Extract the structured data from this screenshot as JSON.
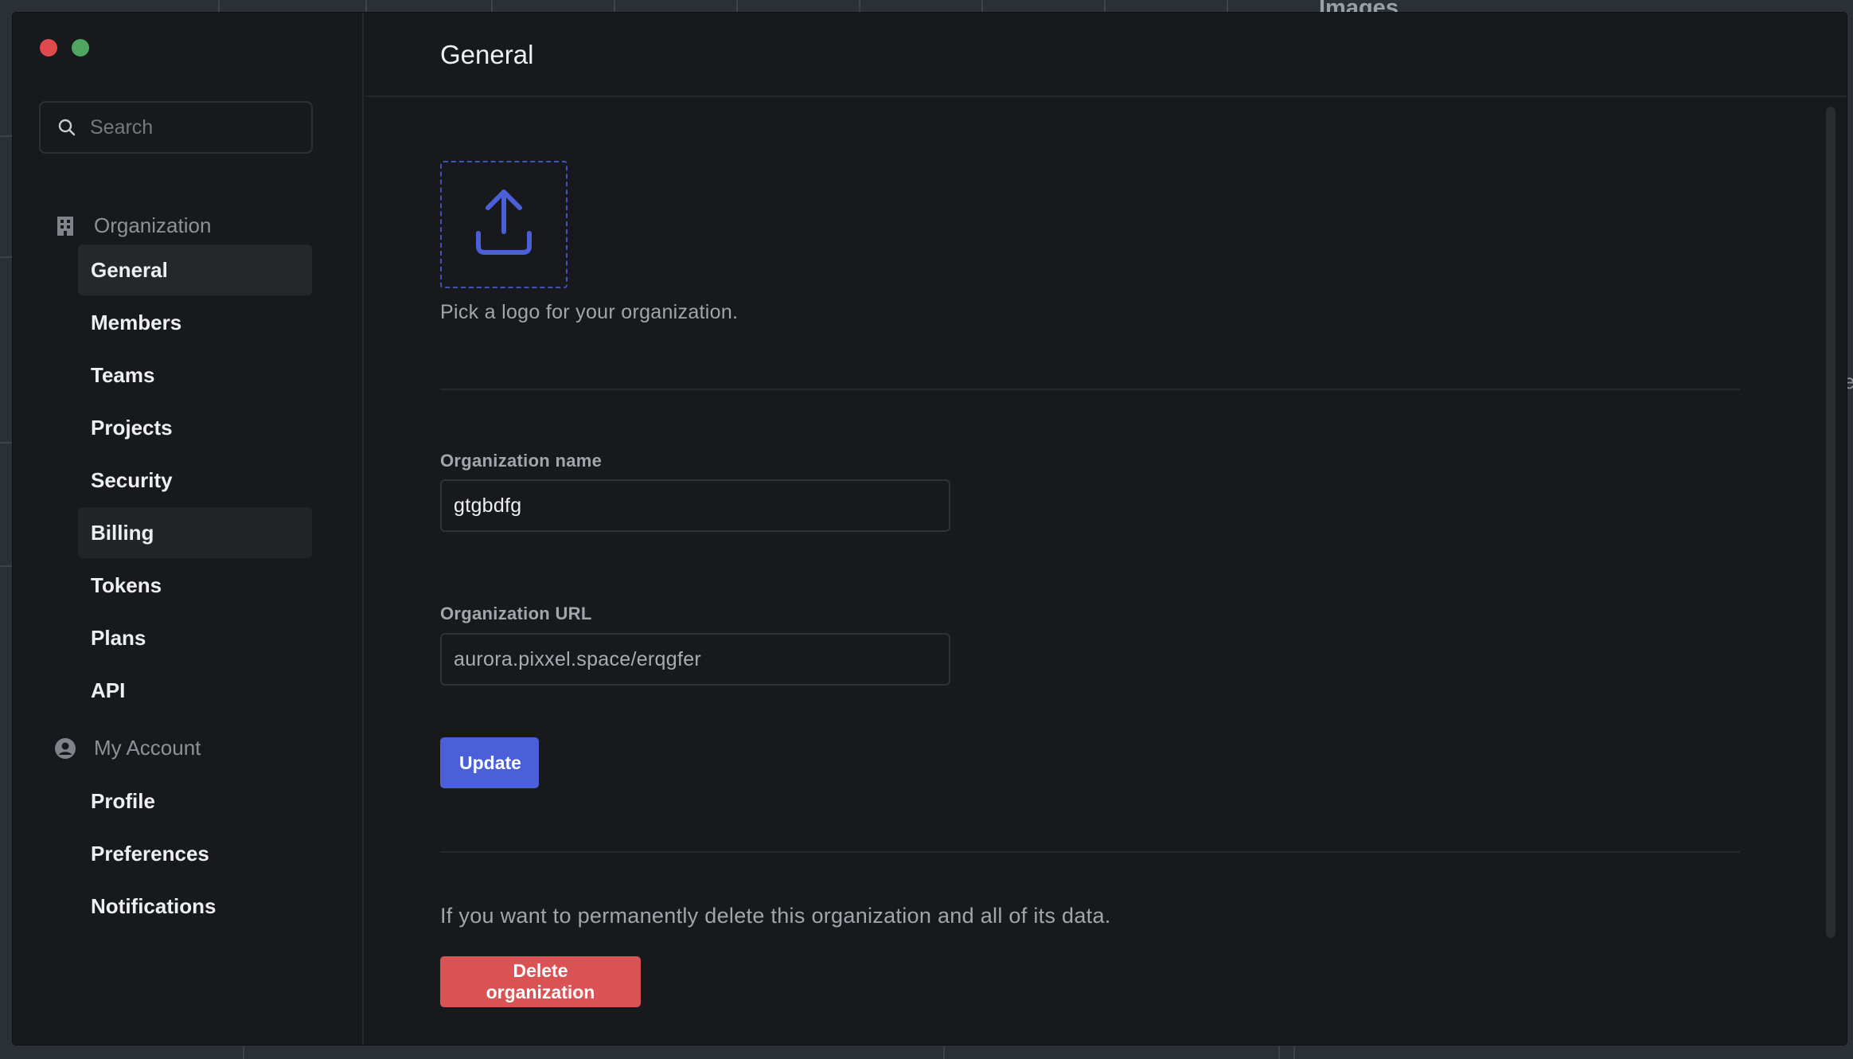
{
  "backdrop": {
    "title": "Images"
  },
  "window": {
    "controls": [
      "close",
      "maximize"
    ]
  },
  "sidebar": {
    "search": {
      "placeholder": "Search",
      "value": ""
    },
    "sections": [
      {
        "label": "Organization",
        "icon": "building-icon",
        "items": [
          {
            "label": "General",
            "state": "active"
          },
          {
            "label": "Members"
          },
          {
            "label": "Teams"
          },
          {
            "label": "Projects"
          },
          {
            "label": "Security"
          },
          {
            "label": "Billing",
            "state": "hovered"
          },
          {
            "label": "Tokens"
          },
          {
            "label": "Plans"
          },
          {
            "label": "API"
          }
        ]
      },
      {
        "label": "My Account",
        "icon": "user-circle-icon",
        "items": [
          {
            "label": "Profile"
          },
          {
            "label": "Preferences"
          },
          {
            "label": "Notifications"
          }
        ]
      }
    ]
  },
  "main": {
    "title": "General",
    "logo": {
      "icon": "upload-icon",
      "hint": "Pick a logo for your organization."
    },
    "org_name": {
      "label": "Organization name",
      "value": "gtgbdfg"
    },
    "org_url": {
      "label": "Organization URL",
      "value": "aurora.pixxel.space/erqgfer"
    },
    "update_label": "Update",
    "delete_text": "If you want to permanently delete this organization and all of its data.",
    "delete_label": "Delete organization"
  },
  "colors": {
    "accent": "#4a5fd8",
    "danger": "#da5354",
    "background": "#18191c",
    "close": "#e0494d",
    "maximize": "#4fa661"
  }
}
